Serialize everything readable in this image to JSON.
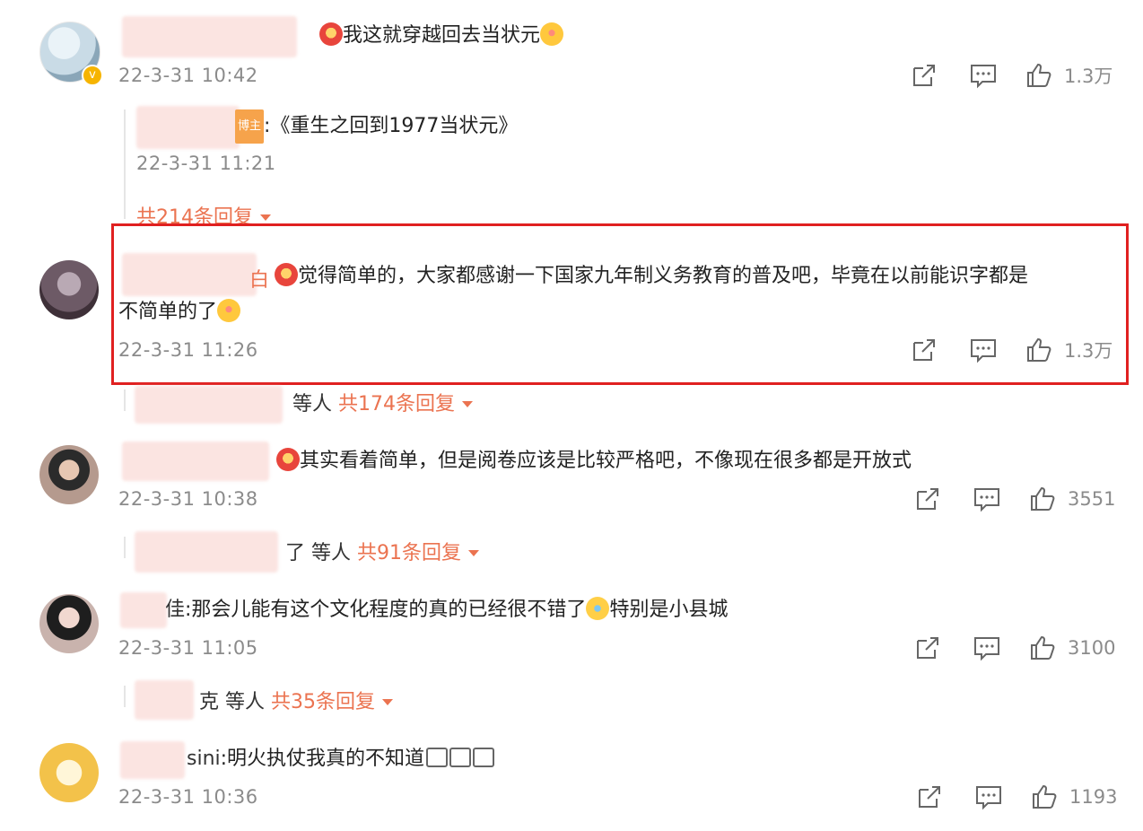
{
  "comments": [
    {
      "text": "我这就穿越回去当状元",
      "time": "22-3-31 10:42",
      "likes": "1.3万",
      "reply": {
        "text": ":《重生之回到1977当状元》",
        "time": "22-3-31 11:21",
        "tag": "博主"
      },
      "replies_link": "共214条回复"
    },
    {
      "text_line1": "觉得简单的，大家都感谢一下国家九年制义务教育的普及吧，毕竟在以前能识字都是",
      "text_line2": "不简单的了",
      "name_suffix": "白",
      "time": "22-3-31 11:26",
      "likes": "1.3万",
      "replies_prefix": "等人",
      "replies_link": "共174条回复"
    },
    {
      "text": "其实看着简单，但是阅卷应该是比较严格吧，不像现在很多都是开放式",
      "time": "22-3-31 10:38",
      "likes": "3551",
      "replies_prefix": "了 等人",
      "replies_link": "共91条回复"
    },
    {
      "name_suffix": "佳",
      "text_a": ":那会儿能有这个文化程度的真的已经很不错了",
      "text_b": "特别是小县城",
      "time": "22-3-31 11:05",
      "likes": "3100",
      "replies_prefix": "克 等人",
      "replies_link": "共35条回复"
    },
    {
      "name_suffix": "sini",
      "text": ":明火执仗我真的不知道",
      "time": "22-3-31 10:36",
      "likes": "1193"
    }
  ],
  "colors": {
    "accent": "#eb7350",
    "highlight": "#e02020",
    "meta": "#8b8b8b"
  },
  "icons": [
    "share-icon",
    "comment-icon",
    "like-icon",
    "expand-caret-icon"
  ]
}
